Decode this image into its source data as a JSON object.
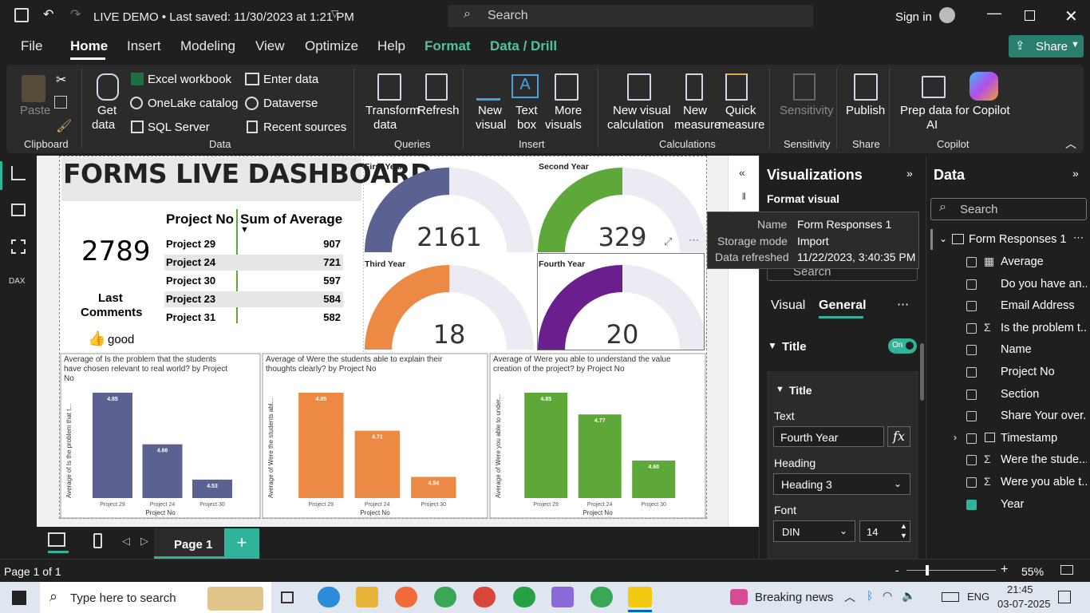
{
  "titlebar": {
    "doc_title": "LIVE DEMO • Last saved: 11/30/2023 at 1:21 PM",
    "search_placeholder": "Search",
    "sign_in": "Sign in"
  },
  "menu": {
    "file": "File",
    "home": "Home",
    "insert": "Insert",
    "modeling": "Modeling",
    "view": "View",
    "optimize": "Optimize",
    "help": "Help",
    "format": "Format",
    "data_drill": "Data / Drill",
    "share": "Share"
  },
  "ribbon": {
    "paste": "Paste",
    "clipboard": "Clipboard",
    "get_data": "Get",
    "get_data2": "data",
    "excel": "Excel workbook",
    "onelake": "OneLake catalog",
    "sql": "SQL Server",
    "enter_data": "Enter data",
    "dataverse": "Dataverse",
    "recent": "Recent sources",
    "data_group": "Data",
    "transform": "Transform",
    "transform2": "data",
    "refresh": "Refresh",
    "queries": "Queries",
    "new_visual": "New",
    "new_visual2": "visual",
    "text_box": "Text",
    "text_box2": "box",
    "more_visuals": "More",
    "more_visuals2": "visuals",
    "insert_group": "Insert",
    "new_visual_calc": "New visual",
    "new_visual_calc2": "calculation",
    "new_measure": "New",
    "new_measure2": "measure",
    "quick_measure": "Quick",
    "quick_measure2": "measure",
    "calculations": "Calculations",
    "sensitivity": "Sensitivity",
    "sensitivity_group": "Sensitivity",
    "publish": "Publish",
    "share_group": "Share",
    "prep_copilot": "Prep data for Copilot",
    "prep_copilot2": "AI",
    "copilot": "Copilot"
  },
  "dashboard": {
    "title": "FORMS LIVE DASHBOARD",
    "card_value": "2789",
    "last_comments": "Last",
    "last_comments2": "Comments",
    "good": "good",
    "table": {
      "col1": "Project No",
      "col2": "Sum of Average",
      "rows": [
        {
          "p": "Project 29",
          "v": "907"
        },
        {
          "p": "Project 24",
          "v": "721"
        },
        {
          "p": "Project 30",
          "v": "597"
        },
        {
          "p": "Project 23",
          "v": "584"
        },
        {
          "p": "Project 31",
          "v": "582"
        }
      ]
    },
    "gauges": [
      {
        "label": "First Year",
        "value": "2161",
        "color": "#5b6190"
      },
      {
        "label": "Second Year",
        "value": "329",
        "color": "#5ea83a"
      },
      {
        "label": "Third Year",
        "value": "18",
        "color": "#ec8a45"
      },
      {
        "label": "Fourth Year",
        "value": "20",
        "color": "#6b1f8c"
      }
    ]
  },
  "chart_data": [
    {
      "type": "bar",
      "title": "Average of Is the problem that the students have chosen relevant to real world? by Project No",
      "xlabel": "Project No",
      "ylabel": "Average of Is the problem that t...",
      "categories": [
        "Project 29",
        "Project 24",
        "Project 30"
      ],
      "values": [
        4.85,
        4.66,
        4.53
      ],
      "color": "#5b6190"
    },
    {
      "type": "bar",
      "title": "Average of Were the students able to explain their thoughts clearly? by Project No",
      "xlabel": "Project No",
      "ylabel": "Average of Were the students abl...",
      "categories": [
        "Project 29",
        "Project 24",
        "Project 30"
      ],
      "values": [
        4.85,
        4.71,
        4.54
      ],
      "color": "#ec8a45"
    },
    {
      "type": "bar",
      "title": "Average of Were you able to understand the value creation of the project? by Project No",
      "xlabel": "Project No",
      "ylabel": "Average of Were you able to under...",
      "categories": [
        "Project 29",
        "Project 24",
        "Project 30"
      ],
      "values": [
        4.85,
        4.77,
        4.6
      ],
      "color": "#5ea83a"
    }
  ],
  "pages": {
    "page1": "Page 1",
    "page_status": "Page 1 of 1",
    "zoom": "55%"
  },
  "viz": {
    "title": "Visualizations",
    "format_visual": "Format visual",
    "search": "Search",
    "tab_visual": "Visual",
    "tab_general": "General",
    "title_section": "Title",
    "toggle": "On",
    "title_sub": "Title",
    "text_label": "Text",
    "text_value": "Fourth Year",
    "heading_label": "Heading",
    "heading_value": "Heading 3",
    "font_label": "Font",
    "font_value": "DIN",
    "font_size": "14"
  },
  "tooltip": {
    "name_k": "Name",
    "name_v": "Form Responses 1",
    "storage_k": "Storage mode",
    "storage_v": "Import",
    "refresh_k": "Data refreshed",
    "refresh_v": "11/22/2023, 3:40:35 PM"
  },
  "data_pane": {
    "title": "Data",
    "search": "Search",
    "table": "Form Responses 1",
    "fields": [
      "Average",
      "Do you have an...",
      "Email Address",
      "Is the problem t...",
      "Name",
      "Project No",
      "Section",
      "Share Your over...",
      "Timestamp",
      "Were the stude...",
      "Were you able t...",
      "Year"
    ]
  },
  "taskbar": {
    "search": "Type here to search",
    "news": "Breaking news",
    "lang": "ENG",
    "time": "21:45",
    "date": "03-07-2025"
  }
}
